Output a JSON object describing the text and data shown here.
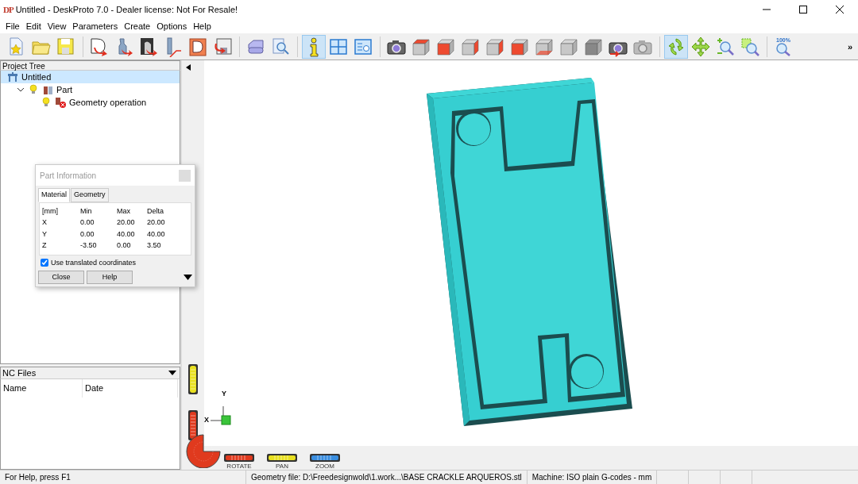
{
  "window": {
    "logo": "DP",
    "title": "Untitled - DeskProto 7.0 - Dealer license: Not For Resale!"
  },
  "menu": [
    "File",
    "Edit",
    "View",
    "Parameters",
    "Create",
    "Options",
    "Help"
  ],
  "toolbar": [
    {
      "kind": "new",
      "selected": false
    },
    {
      "kind": "open",
      "selected": false
    },
    {
      "kind": "save",
      "selected": false
    },
    {
      "kind": "sep"
    },
    {
      "kind": "import-d",
      "selected": false
    },
    {
      "kind": "import-figure",
      "selected": false
    },
    {
      "kind": "import-photo",
      "selected": false
    },
    {
      "kind": "import-tool",
      "selected": false
    },
    {
      "kind": "letter-d",
      "selected": false
    },
    {
      "kind": "export",
      "selected": false
    },
    {
      "kind": "sep"
    },
    {
      "kind": "print",
      "selected": false
    },
    {
      "kind": "preview",
      "selected": false
    },
    {
      "kind": "sep"
    },
    {
      "kind": "info",
      "selected": true
    },
    {
      "kind": "grid",
      "selected": false
    },
    {
      "kind": "report",
      "selected": false
    },
    {
      "kind": "sep"
    },
    {
      "kind": "camera",
      "selected": false
    },
    {
      "kind": "cube-top",
      "selected": false
    },
    {
      "kind": "cube-front",
      "selected": false
    },
    {
      "kind": "cube-right",
      "selected": false
    },
    {
      "kind": "cube-back",
      "selected": false
    },
    {
      "kind": "cube-left",
      "selected": false
    },
    {
      "kind": "cube-bottom",
      "selected": false
    },
    {
      "kind": "cube",
      "selected": false
    },
    {
      "kind": "cube-dark",
      "selected": false
    },
    {
      "kind": "camera-restore",
      "selected": false
    },
    {
      "kind": "camera-grey",
      "selected": false
    },
    {
      "kind": "sep"
    },
    {
      "kind": "rotate",
      "selected": true
    },
    {
      "kind": "pan",
      "selected": false
    },
    {
      "kind": "zoom",
      "selected": false
    },
    {
      "kind": "zoom-window",
      "selected": false
    },
    {
      "kind": "sep"
    },
    {
      "kind": "zoom-all",
      "selected": false,
      "label": "100%"
    }
  ],
  "toolbar_more": "»",
  "project_tree": {
    "title": "Project Tree",
    "items": [
      {
        "label": "Untitled",
        "kind": "project",
        "selected": true,
        "children": [
          {
            "label": "Part",
            "kind": "part",
            "selected": false,
            "expanded": true,
            "children": [
              {
                "label": "Geometry operation",
                "kind": "operation",
                "selected": false
              }
            ]
          }
        ]
      }
    ]
  },
  "nc_files": {
    "title": "NC Files",
    "columns": [
      "Name",
      "Date"
    ]
  },
  "part_information": {
    "title": "Part Information",
    "tabs": [
      {
        "label": "Material",
        "selected": true
      },
      {
        "label": "Geometry",
        "selected": false
      }
    ],
    "rows": [
      [
        "[mm]",
        "Min",
        "Max",
        "Delta"
      ],
      [
        "X",
        "0.00",
        "20.00",
        "20.00"
      ],
      [
        "Y",
        "0.00",
        "40.00",
        "40.00"
      ],
      [
        "Z",
        "-3.50",
        "0.00",
        "3.50"
      ]
    ],
    "use_translated": {
      "label": "Use translated coordinates",
      "checked": true
    },
    "buttons": [
      "Close",
      "Help"
    ]
  },
  "viewport": {
    "axes": {
      "x": "X",
      "y": "Y"
    },
    "wheels": [
      {
        "label": "ROTATE",
        "color": "#e03a1e"
      },
      {
        "label": "PAN",
        "color": "#e8e020"
      },
      {
        "label": "ZOOM",
        "color": "#3a8ee0"
      }
    ]
  },
  "status_bar": [
    "For Help, press F1",
    "Geometry file: D:\\Freedesignwold\\1.work...\\BASE CRACKLE ARQUEROS.stl",
    "Machine: ISO plain G-codes - mm"
  ]
}
